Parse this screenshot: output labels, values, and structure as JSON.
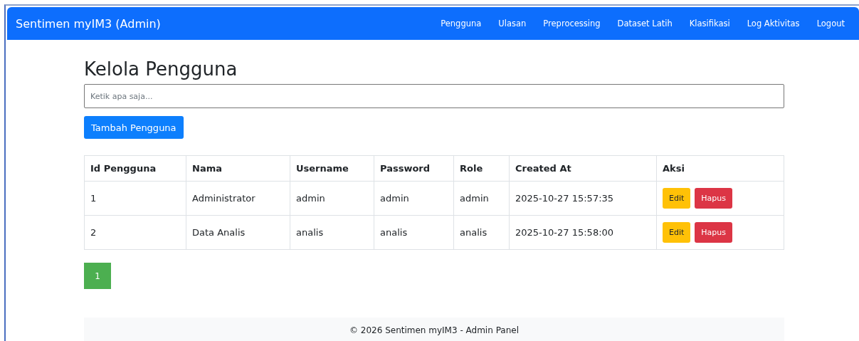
{
  "navbar": {
    "brand": "Sentimen myIM3 (Admin)",
    "links": [
      "Pengguna",
      "Ulasan",
      "Preprocessing",
      "Dataset Latih",
      "Klasifikasi",
      "Log Aktivitas",
      "Logout"
    ]
  },
  "page": {
    "title": "Kelola Pengguna",
    "search": {
      "placeholder": "Ketik apa saja..."
    },
    "add_button": "Tambah Pengguna"
  },
  "table": {
    "columns": [
      "Id Pengguna",
      "Nama",
      "Username",
      "Password",
      "Role",
      "Created At",
      "Aksi"
    ],
    "rows": [
      {
        "cells": [
          "1",
          "Administrator",
          "admin",
          "admin",
          "admin",
          "2025-10-27 15:57:35"
        ],
        "actions": [
          {
            "kind": "edit",
            "label": "Edit"
          },
          {
            "kind": "delete",
            "label": "Hapus"
          }
        ]
      },
      {
        "cells": [
          "2",
          "Data Analis",
          "analis",
          "analis",
          "analis",
          "2025-10-27 15:58:00"
        ],
        "actions": [
          {
            "kind": "edit",
            "label": "Edit"
          },
          {
            "kind": "delete",
            "label": "Hapus"
          }
        ]
      }
    ]
  },
  "pagination": [
    {
      "label": "1",
      "selected": true
    }
  ],
  "footer": "© 2026 Sentimen myIM3 - Admin Panel"
}
